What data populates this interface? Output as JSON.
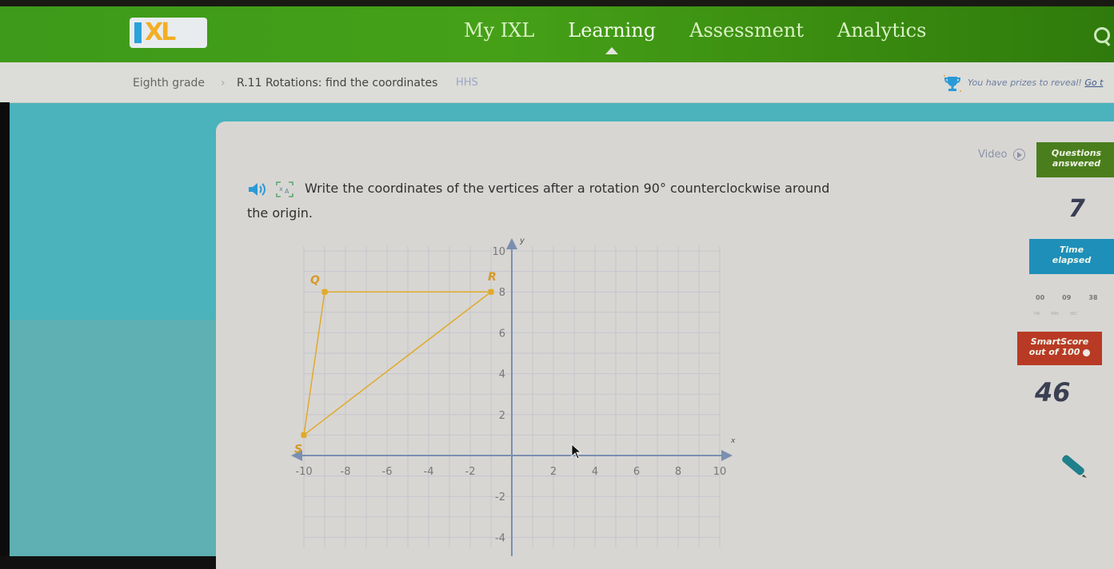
{
  "header": {
    "logo": "IXL",
    "nav": [
      {
        "label": "My IXL",
        "active": false
      },
      {
        "label": "Learning",
        "active": true
      },
      {
        "label": "Assessment",
        "active": false
      },
      {
        "label": "Analytics",
        "active": false
      }
    ],
    "search_icon": "search-icon"
  },
  "breadcrumb": {
    "grade": "Eighth grade",
    "separator": "›",
    "skill": "R.11 Rotations: find the coordinates",
    "code": "HHS"
  },
  "prizes": {
    "icon": "trophy-icon",
    "text": "You have prizes to reveal!",
    "link": "Go t"
  },
  "question": {
    "speaker_icon": "speaker-icon",
    "translate_icon": "translate-icon",
    "line1": "Write the coordinates of the vertices after a rotation 90° counterclockwise around",
    "line2": "the origin."
  },
  "sidebar": {
    "video_label": "Video",
    "questions_answered_label_1": "Questions",
    "questions_answered_label_2": "answered",
    "questions_answered_value": "7",
    "time_label_1": "Time",
    "time_label_2": "elapsed",
    "time": {
      "hr": "00",
      "min": "09",
      "sec": "38"
    },
    "time_units": [
      "HR",
      "MIN",
      "SEC"
    ],
    "smartscore_label_1": "SmartScore",
    "smartscore_label_2": "out of 100",
    "smartscore_value": "46"
  },
  "chart_data": {
    "type": "scatter",
    "title": "",
    "xlabel": "x",
    "ylabel": "y",
    "xlim": [
      -10,
      10
    ],
    "ylim": [
      -4.5,
      10
    ],
    "grid": true,
    "x_ticks": [
      -10,
      -8,
      -6,
      -4,
      -2,
      2,
      4,
      6,
      8,
      10
    ],
    "y_ticks": [
      10,
      8,
      6,
      4,
      2,
      -2,
      -4
    ],
    "shape_color": "#e0aa2a",
    "axis_color": "#7a8fb0",
    "points": [
      {
        "label": "Q",
        "x": -9,
        "y": 8
      },
      {
        "label": "R",
        "x": -1,
        "y": 8
      },
      {
        "label": "S",
        "x": -10,
        "y": 1
      }
    ],
    "polygon_order": [
      "Q",
      "R",
      "S"
    ]
  }
}
